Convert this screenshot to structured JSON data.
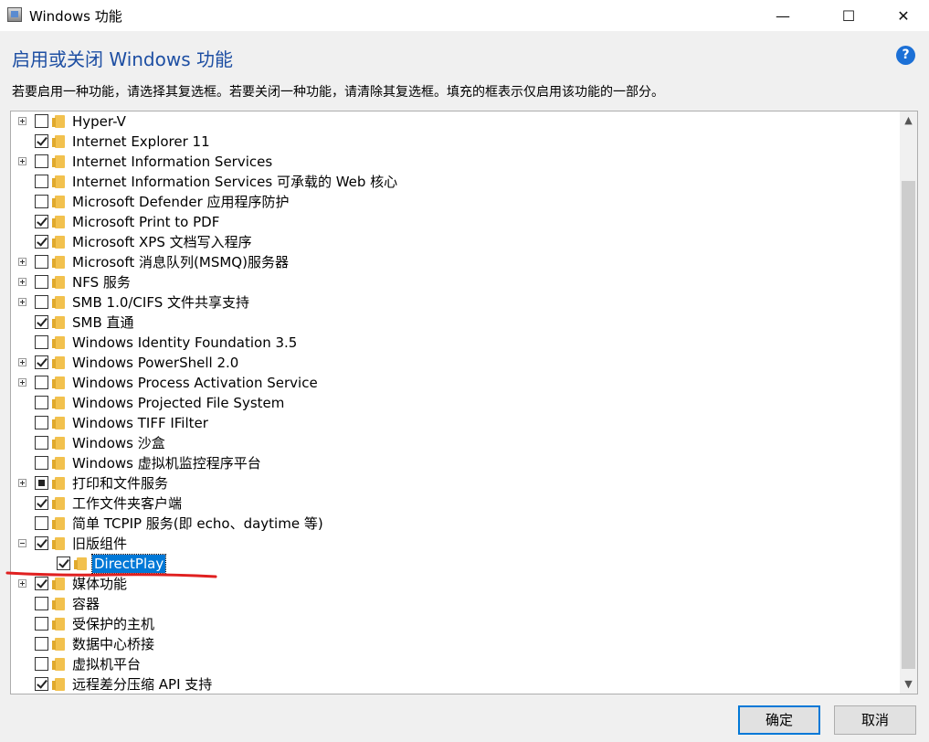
{
  "window": {
    "title": "Windows 功能",
    "minimize_glyph": "—",
    "maximize_glyph": "☐",
    "close_glyph": "✕"
  },
  "heading": "启用或关闭 Windows 功能",
  "help_glyph": "?",
  "instructions": "若要启用一种功能，请选择其复选框。若要关闭一种功能，请清除其复选框。填充的框表示仅启用该功能的一部分。",
  "features": [
    {
      "label": "Hyper-V",
      "state": "unchecked",
      "expander": "plus",
      "level": 0
    },
    {
      "label": "Internet Explorer 11",
      "state": "checked",
      "expander": "none",
      "level": 0
    },
    {
      "label": "Internet Information Services",
      "state": "unchecked",
      "expander": "plus",
      "level": 0
    },
    {
      "label": "Internet Information Services 可承载的 Web 核心",
      "state": "unchecked",
      "expander": "none",
      "level": 0
    },
    {
      "label": "Microsoft Defender 应用程序防护",
      "state": "unchecked",
      "expander": "none",
      "level": 0
    },
    {
      "label": "Microsoft Print to PDF",
      "state": "checked",
      "expander": "none",
      "level": 0
    },
    {
      "label": "Microsoft XPS 文档写入程序",
      "state": "checked",
      "expander": "none",
      "level": 0
    },
    {
      "label": "Microsoft 消息队列(MSMQ)服务器",
      "state": "unchecked",
      "expander": "plus",
      "level": 0
    },
    {
      "label": "NFS 服务",
      "state": "unchecked",
      "expander": "plus",
      "level": 0
    },
    {
      "label": "SMB 1.0/CIFS 文件共享支持",
      "state": "unchecked",
      "expander": "plus",
      "level": 0
    },
    {
      "label": "SMB 直通",
      "state": "checked",
      "expander": "none",
      "level": 0
    },
    {
      "label": "Windows Identity Foundation 3.5",
      "state": "unchecked",
      "expander": "none",
      "level": 0
    },
    {
      "label": "Windows PowerShell 2.0",
      "state": "checked",
      "expander": "plus",
      "level": 0
    },
    {
      "label": "Windows Process Activation Service",
      "state": "unchecked",
      "expander": "plus",
      "level": 0
    },
    {
      "label": "Windows Projected File System",
      "state": "unchecked",
      "expander": "none",
      "level": 0
    },
    {
      "label": "Windows TIFF IFilter",
      "state": "unchecked",
      "expander": "none",
      "level": 0
    },
    {
      "label": "Windows 沙盒",
      "state": "unchecked",
      "expander": "none",
      "level": 0
    },
    {
      "label": "Windows 虚拟机监控程序平台",
      "state": "unchecked",
      "expander": "none",
      "level": 0
    },
    {
      "label": "打印和文件服务",
      "state": "partial",
      "expander": "plus",
      "level": 0
    },
    {
      "label": "工作文件夹客户端",
      "state": "checked",
      "expander": "none",
      "level": 0
    },
    {
      "label": "简单 TCPIP 服务(即 echo、daytime 等)",
      "state": "unchecked",
      "expander": "none",
      "level": 0
    },
    {
      "label": "旧版组件",
      "state": "checked",
      "expander": "minus",
      "level": 0
    },
    {
      "label": "DirectPlay",
      "state": "checked",
      "expander": "none",
      "level": 1,
      "selected": true
    },
    {
      "label": "媒体功能",
      "state": "checked",
      "expander": "plus",
      "level": 0
    },
    {
      "label": "容器",
      "state": "unchecked",
      "expander": "none",
      "level": 0
    },
    {
      "label": "受保护的主机",
      "state": "unchecked",
      "expander": "none",
      "level": 0
    },
    {
      "label": "数据中心桥接",
      "state": "unchecked",
      "expander": "none",
      "level": 0
    },
    {
      "label": "虚拟机平台",
      "state": "unchecked",
      "expander": "none",
      "level": 0
    },
    {
      "label": "远程差分压缩 API 支持",
      "state": "checked",
      "expander": "none",
      "level": 0
    }
  ],
  "scrollbar": {
    "up_glyph": "▲",
    "down_glyph": "▼"
  },
  "buttons": {
    "ok": "确定",
    "cancel": "取消"
  },
  "colors": {
    "heading": "#1e4fa3",
    "selection": "#0078d7",
    "annotation": "#e02020"
  }
}
